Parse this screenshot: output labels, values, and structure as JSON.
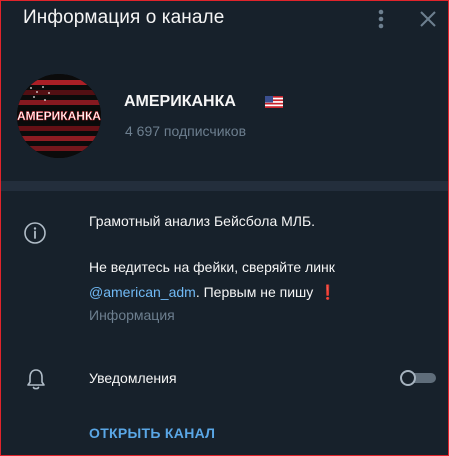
{
  "header": {
    "title": "Информация о канале",
    "menu_icon": "more-vertical-icon",
    "close_icon": "close-icon"
  },
  "profile": {
    "avatar_text": "АМЕРИКАНКА",
    "name": "АМЕРИКАНКА",
    "flag_icon": "us-flag-icon",
    "subscribers": "4 697 подписчиков"
  },
  "info": {
    "icon": "info-icon",
    "line1": "Грамотный анализ Бейсбола МЛБ.",
    "line2": "Не ведитесь на фейки, сверяйте линк",
    "link": "@american_adm",
    "line3_rest": ". Первым не пишу",
    "exclamation": "❗",
    "caption": "Информация"
  },
  "notifications": {
    "icon": "bell-icon",
    "label": "Уведомления",
    "enabled": false
  },
  "actions": {
    "open_channel": "ОТКРЫТЬ КАНАЛ"
  },
  "colors": {
    "background": "#17212b",
    "divider": "#232e3c",
    "link": "#71baf5",
    "accent": "#5aa7e6",
    "muted": "#6d7f8f",
    "border": "#e0242b"
  }
}
